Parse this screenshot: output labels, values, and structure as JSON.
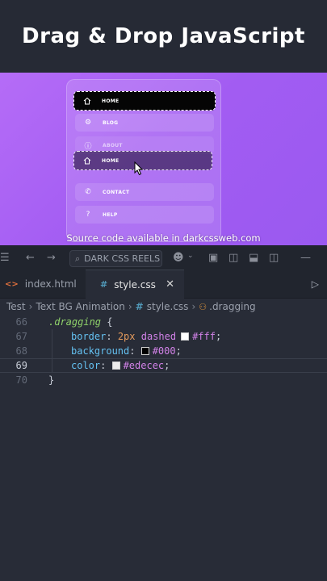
{
  "title": "Drag & Drop JavaScript",
  "preview": {
    "menu": [
      {
        "label": "HOME",
        "icon": "home-icon",
        "state": "dragging"
      },
      {
        "label": "BLOG",
        "icon": "gear-icon",
        "state": "normal"
      },
      {
        "label": "ABOUT",
        "icon": "info-icon",
        "state": "faded"
      },
      {
        "label": "HOME",
        "icon": "home-icon",
        "state": "ghost"
      },
      {
        "label": "CONTACT",
        "icon": "phone-icon",
        "state": "normal"
      },
      {
        "label": "HELP",
        "icon": "question-icon",
        "state": "normal"
      }
    ],
    "watermark": "Source code available in darkcssweb.com"
  },
  "toolbar": {
    "search_text": "DARK CSS REELS"
  },
  "tabs": [
    {
      "label": "index.html",
      "glyph": "<>",
      "active": false
    },
    {
      "label": "style.css",
      "glyph": "#",
      "active": true
    }
  ],
  "breadcrumb": {
    "items": [
      "Test",
      "Text BG Animation",
      "style.css",
      ".dragging"
    ]
  },
  "editor": {
    "lines": [
      {
        "num": "66",
        "selector": ".dragging",
        "brace": " {"
      },
      {
        "num": "67",
        "prop": "border",
        "num_val": "2px",
        "rest": " dashed",
        "color": "#fff",
        "swatch": "#ffffff"
      },
      {
        "num": "68",
        "prop": "background",
        "color": "#000",
        "swatch": "#000000"
      },
      {
        "num": "69",
        "prop": "color",
        "color": "#edecec",
        "swatch": "#edecec"
      },
      {
        "num": "70",
        "brace": "}"
      }
    ]
  },
  "colors": {
    "accent_purple": "#a25cf2",
    "editor_bg": "#282c37",
    "chrome_bg": "#21252e"
  }
}
